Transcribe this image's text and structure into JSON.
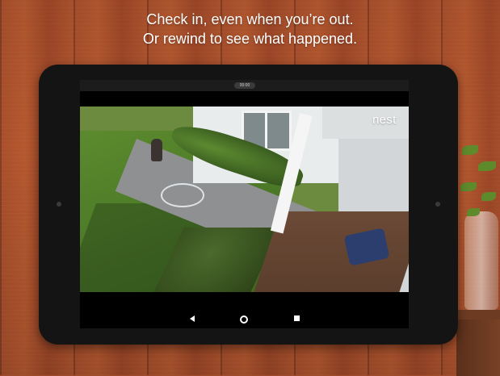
{
  "caption": {
    "line1": "Check in, even when you’re out.",
    "line2": "Or rewind to see what happened."
  },
  "tablet": {
    "status_pill": "00:00",
    "brand_logo": "nest",
    "icons": {
      "back": "back-triangle-icon",
      "home": "home-circle-icon",
      "recent": "recent-apps-square-icon"
    }
  },
  "colors": {
    "wood": "#a94f2c",
    "device_bezel": "#141414",
    "caption_text": "#ffffff"
  }
}
